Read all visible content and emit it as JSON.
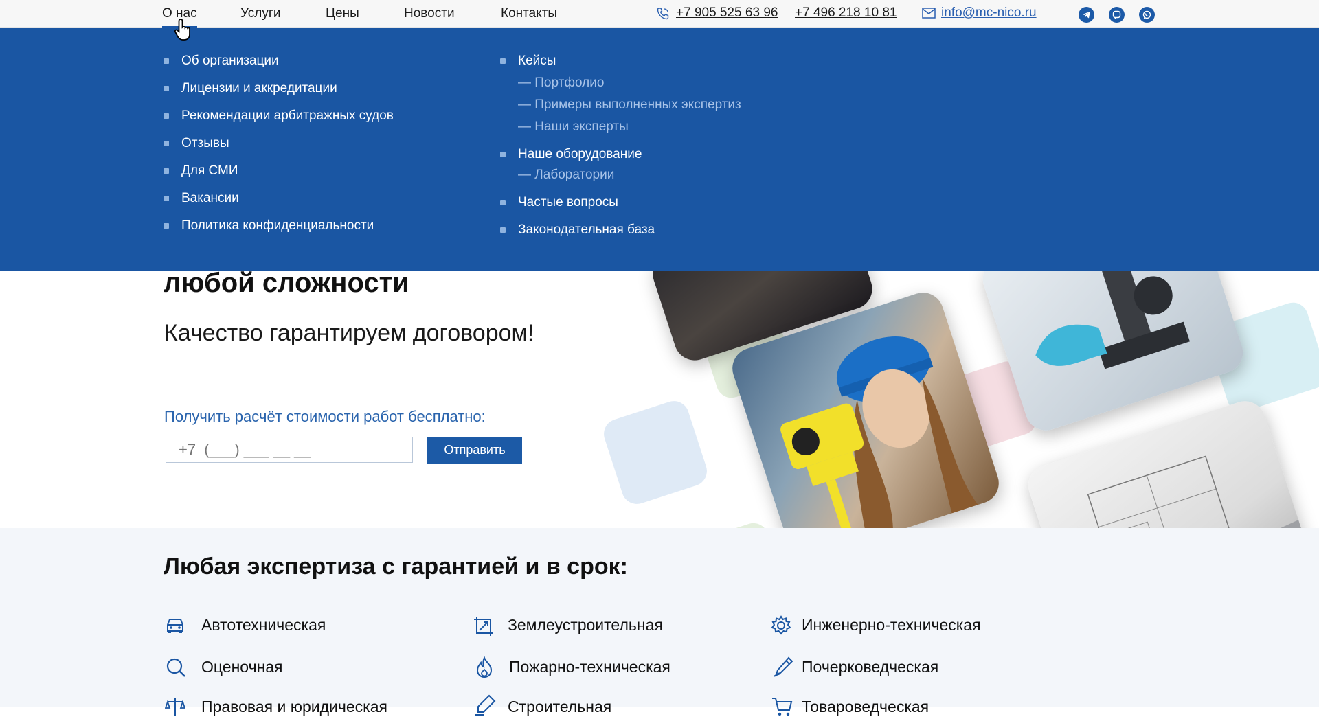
{
  "nav": {
    "items": [
      "О нас",
      "Услуги",
      "Цены",
      "Новости",
      "Контакты"
    ],
    "active": "О нас"
  },
  "contacts": {
    "phone1": "+7 905 525 63 96",
    "phone2": "+7 496 218 10 81",
    "email": "info@mc-nico.ru",
    "icons": [
      "phone-icon",
      "mail-icon",
      "telegram-icon",
      "viber-icon",
      "whatsapp-icon"
    ]
  },
  "dropdown": {
    "col1": [
      "Об организации",
      "Лицензии и аккредитации",
      "Рекомендации арбитражных судов",
      "Отзывы",
      "Для СМИ",
      "Вакансии",
      "Политика конфиденциальности"
    ],
    "col2": {
      "cases": "Кейсы",
      "cases_sub": [
        "— Портфолио",
        "— Примеры выполненных экспертиз",
        "— Наши эксперты"
      ],
      "equipment": "Наше оборудование",
      "equipment_sub": [
        "— Лаборатории"
      ],
      "faq": "Частые вопросы",
      "law": "Законодательная база"
    }
  },
  "hero": {
    "title_line": "любой сложности",
    "subtitle": "Качество гарантируем договором!",
    "calc_label": "Получить расчёт стоимости работ бесплатно:",
    "phone_placeholder": "+7  (___) ___ __ __",
    "send_label": "Отправить"
  },
  "services": {
    "title": "Любая экспертиза с гарантией и в срок:",
    "items": [
      {
        "label": "Автотехническая",
        "icon": "car-icon"
      },
      {
        "label": "Землеустроительная",
        "icon": "land-measure-icon"
      },
      {
        "label": "Инженерно-техническая",
        "icon": "gear-icon"
      },
      {
        "label": "Оценочная",
        "icon": "search-icon"
      },
      {
        "label": "Пожарно-техническая",
        "icon": "fire-icon"
      },
      {
        "label": "Почерковедческая",
        "icon": "pen-icon"
      },
      {
        "label": "Правовая и юридическая",
        "icon": "scales-icon"
      },
      {
        "label": "Строительная",
        "icon": "build-icon"
      },
      {
        "label": "Товароведческая",
        "icon": "cart-icon"
      }
    ]
  },
  "colors": {
    "brand_blue": "#1a56a3",
    "link_blue": "#2a64ad",
    "dropdown_sub": "#a8c3e8",
    "services_bg": "#f3f6fa"
  }
}
